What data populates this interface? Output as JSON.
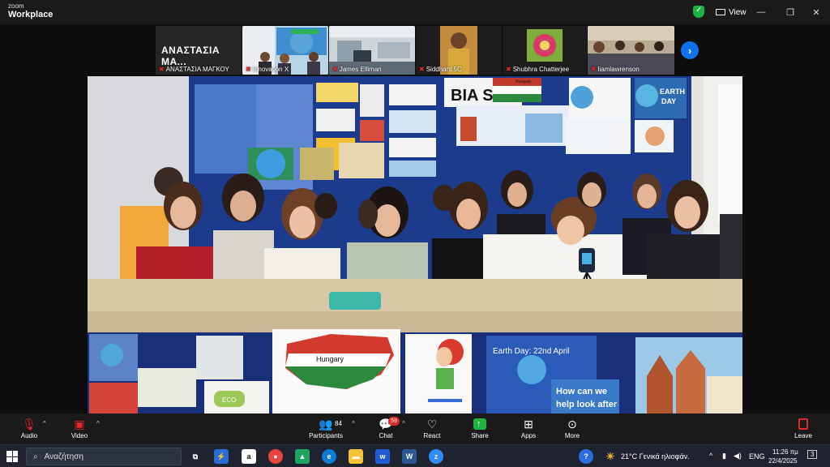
{
  "app": {
    "brand_line1": "zoom",
    "brand_line2": "Workplace"
  },
  "titlebar": {
    "view_label": "View"
  },
  "thumbnails": [
    {
      "name": "ΑΝΑΣΤΑΣΙΑ ΜΑΓΚΟΥ",
      "big_name": "ΑΝΑΣΤΑΣΙΑ  ΜΑ...",
      "muted": true
    },
    {
      "name": "Innovation X",
      "muted": true
    },
    {
      "name": "James Elliman",
      "muted": true
    },
    {
      "name": "Siddhant 5C",
      "muted": true
    },
    {
      "name": "Shubhra Chatterjee",
      "muted": true
    },
    {
      "name": "liamlawrenson",
      "muted": true
    }
  ],
  "video": {
    "signs": {
      "bia": "BIA Suf",
      "hungary_map": "Hungary",
      "hungary_small": "Hungary",
      "earth_day_poster": "Earth Day: 22nd April",
      "how_can_we": "How can we",
      "help_look_after": "help look after",
      "earth": "EARTH",
      "day": "DAY",
      "eco": "ECO"
    }
  },
  "toolbar": {
    "audio_label": "Audio",
    "video_label": "Video",
    "participants_label": "Participants",
    "participants_count": "84",
    "chat_label": "Chat",
    "chat_badge": "59",
    "react_label": "React",
    "share_label": "Share",
    "apps_label": "Apps",
    "more_label": "More",
    "leave_label": "Leave"
  },
  "taskbar": {
    "search_placeholder": "Αναζήτηση",
    "weather": "21°C  Γενικά ηλιοφάν.",
    "language": "ENG",
    "time": "11:26 πμ",
    "date": "22/4/2025",
    "notifications": "3"
  }
}
